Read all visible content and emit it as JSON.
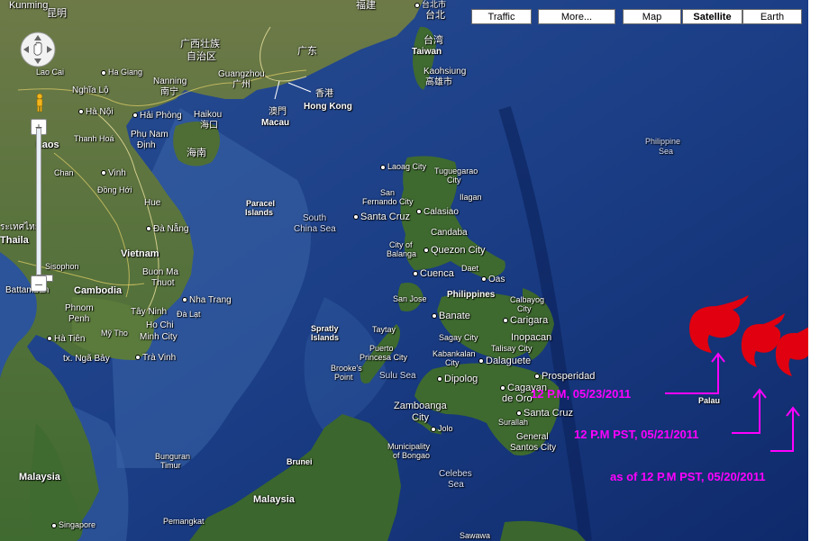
{
  "map_buttons": {
    "traffic": "Traffic",
    "more": "More...",
    "map": "Map",
    "satellite": "Satellite",
    "earth": "Earth"
  },
  "cities": {
    "kunming": "Kunming",
    "kunming_zh": "昆明",
    "fujian": "福建",
    "taipei": "台北市",
    "taipei2": "台北",
    "taiwan_zh": "台湾",
    "taiwan": "Taiwan",
    "kaohsiung": "Kaohsiung",
    "kaohsiung_zh": "高雄市",
    "guangxi": "广西壮族",
    "guangxi2": "自治区",
    "guangdong": "广东",
    "laocai": "Lao Cai",
    "hagiang": "Ha Giang",
    "nanning": "Nanning",
    "nanning_zh": "南宁",
    "guangzhou": "Guangzhou",
    "guangzhou_zh": "广州",
    "hongkong_zh": "香港",
    "hongkong": "Hong Kong",
    "macau_zh": "澳門",
    "macau": "Macau",
    "nghialo": "Nghĩa Lộ",
    "hanoi": "Hà Nội",
    "haiphong": "Hải Phòng",
    "haikou": "Haikou",
    "haikou_zh": "海口",
    "hainan": "海南",
    "thanhhoa": "Thanh Hoá",
    "phunam": "Phụ Nam",
    "dinh": "Định",
    "laos": "Laos",
    "vinh": "Vinh",
    "chan": "Chan",
    "donghoi": "Đồng Hới",
    "hue": "Hue",
    "danang": "Đà Nẵng",
    "thailand_th": "ระเทศไทย",
    "thailand": "Thaila",
    "vietnam": "Vietnam",
    "buonma": "Buon Ma",
    "thuot": "Thuot",
    "sisophon": "Sisophon",
    "battambang": "Battamban",
    "cambodia": "Cambodia",
    "nhatrang": "Nha Trang",
    "phnom": "Phnom",
    "penh": "Penh",
    "taynin": "Tây Ninh",
    "dalat": "Đà Lạt",
    "hochi": "Ho Chi",
    "minhcity": "Minh City",
    "mytho": "Mỹ Tho",
    "hatien": "Hà Tiên",
    "ngabay": "tx. Ngã Bảy",
    "travinh": "Trà Vinh",
    "paracel": "Paracel",
    "islands": "Islands",
    "southchina": "South",
    "chinasea": "China Sea",
    "spratly": "Spratly",
    "spratly2": "Islands",
    "laoag": "Laoag City",
    "tuguegarao": "Tuguegarao",
    "tuguegarao2": "City",
    "ilagan": "Ilagan",
    "sanfernando": "San",
    "sanfernando2": "Fernando City",
    "santacruz": "Santa Cruz",
    "calasiao": "Calasiao",
    "candaba": "Candaba",
    "cityof": "City of",
    "balanga": "Balanga",
    "quezon": "Quezon City",
    "daet": "Daet",
    "cuenca": "Cuenca",
    "oas": "Oas",
    "sanjose": "San Jose",
    "philippines": "Philippines",
    "calbayog": "Calbayog",
    "calbayog2": "City",
    "carigara": "Carigara",
    "taytay": "Taytay",
    "banate": "Banate",
    "inopacan": "Inopacan",
    "sagay": "Sagay City",
    "talisay": "Talisay City",
    "kabankalan": "Kabankalan",
    "kabankalan2": "City",
    "dalaguete": "Dalaguete",
    "puerto": "Puerto",
    "princesa": "Princesa City",
    "brookes": "Brooke's",
    "point": "Point",
    "sulusea": "Sulu Sea",
    "prosperidad": "Prosperidad",
    "dipolog": "Dipolog",
    "cagayan": "Cagayan",
    "deoro": "de Oro",
    "santacruz2": "Santa Cruz",
    "surallah": "Surallah",
    "zamboanga": "Zamboanga",
    "zamboanga2": "City",
    "jolo": "Jolo",
    "general": "General",
    "santos": "Santos City",
    "municipality": "Municipality",
    "ofbongao": "of Bongao",
    "celebes": "Celebes",
    "celebessea": "Sea",
    "brunei": "Brunei",
    "bunguran": "Bunguran",
    "timur": "Timur",
    "malaysia1": "Malaysia",
    "malaysia2": "Malaysia",
    "singapore": "Singapore",
    "pemangkat": "Pemangkat",
    "sawawa": "Sawawa",
    "philippinesea": "Philippine",
    "philippinesea2": "Sea",
    "palau": "Palau"
  },
  "annotations": {
    "a1": "12 P.M, 05/23/2011",
    "a2": "12 P.M PST, 05/21/2011",
    "a3": "as of 12 P.M PST, 05/20/2011"
  },
  "colors": {
    "ocean": "#1c3f86",
    "deep_ocean": "#102d6e",
    "land": "#56733a",
    "annotation": "#ff00ff",
    "storm": "#e00010"
  }
}
